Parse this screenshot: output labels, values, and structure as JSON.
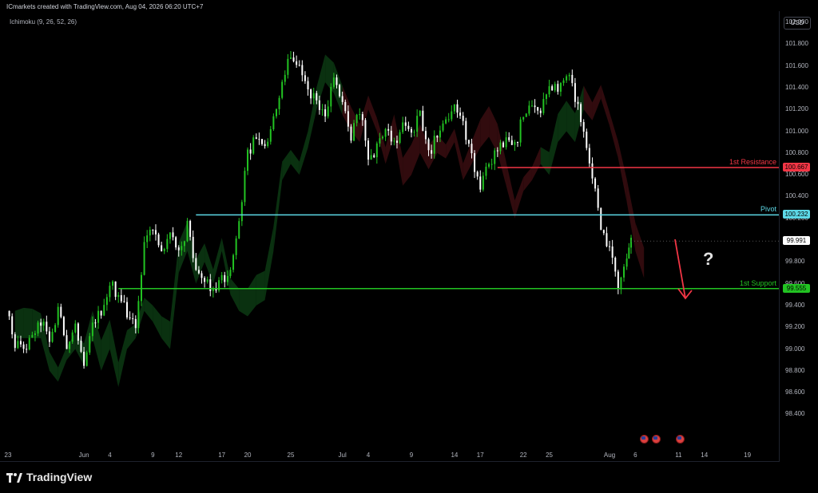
{
  "header": {
    "created": "ICmarkets created with TradingView.com, Aug 04, 2026 06:20 UTC+7",
    "indicator": "Ichimoku (9, 26, 52, 26)",
    "currency": "USD"
  },
  "brand": {
    "name": "TradingView"
  },
  "chart_data": {
    "type": "candlestick",
    "ylim": [
      98.2,
      102.15
    ],
    "y_ticks": [
      "102.000",
      "101.800",
      "101.600",
      "101.400",
      "101.200",
      "101.000",
      "100.800",
      "100.600",
      "100.400",
      "100.200",
      "99.800",
      "99.600",
      "99.400",
      "99.200",
      "99.000",
      "98.800",
      "98.600",
      "98.400"
    ],
    "x_ticks": [
      "23",
      "Jun",
      "4",
      "9",
      "12",
      "17",
      "20",
      "25",
      "Jul",
      "4",
      "9",
      "14",
      "17",
      "22",
      "25",
      "Aug",
      "6",
      "11",
      "14",
      "19"
    ],
    "x_tick_days": [
      -9,
      0,
      3,
      8,
      11,
      16,
      19,
      24,
      30,
      33,
      38,
      43,
      46,
      51,
      54,
      61,
      64,
      69,
      72,
      77
    ],
    "x_range_days": [
      -9,
      80
    ],
    "current_price": "99.991",
    "levels": [
      {
        "name": "1st Resistance",
        "value": "100.667",
        "color": "#f23645",
        "from_day": 48
      },
      {
        "name": "Pivot",
        "value": "100.232",
        "color": "#5dd8e6",
        "from_day": 13
      },
      {
        "name": "1st Support",
        "value": "99.555",
        "color": "#22c322",
        "from_day": 4
      }
    ],
    "annotation": "?",
    "price_path": [
      [
        -9,
        99.35
      ],
      [
        -8,
        99.05
      ],
      [
        -7,
        98.95
      ],
      [
        -6,
        99.15
      ],
      [
        -5,
        99.25
      ],
      [
        -4,
        99.1
      ],
      [
        -3,
        99.35
      ],
      [
        -2,
        99.05
      ],
      [
        -1,
        99.25
      ],
      [
        0,
        98.9
      ],
      [
        1,
        99.25
      ],
      [
        2,
        99.35
      ],
      [
        3,
        99.6
      ],
      [
        4,
        99.5
      ],
      [
        5,
        99.35
      ],
      [
        6,
        99.25
      ],
      [
        7,
        99.95
      ],
      [
        8,
        100.15
      ],
      [
        9,
        99.85
      ],
      [
        10,
        100.05
      ],
      [
        11,
        99.85
      ],
      [
        12,
        100.15
      ],
      [
        13,
        99.75
      ],
      [
        14,
        99.6
      ],
      [
        15,
        99.55
      ],
      [
        16,
        99.65
      ],
      [
        17,
        99.7
      ],
      [
        18,
        100.15
      ],
      [
        19,
        100.8
      ],
      [
        20,
        100.95
      ],
      [
        21,
        100.85
      ],
      [
        22,
        101.1
      ],
      [
        23,
        101.45
      ],
      [
        24,
        101.7
      ],
      [
        25,
        101.6
      ],
      [
        26,
        101.4
      ],
      [
        27,
        101.25
      ],
      [
        28,
        101.15
      ],
      [
        29,
        101.45
      ],
      [
        30,
        101.25
      ],
      [
        31,
        100.95
      ],
      [
        32,
        101.2
      ],
      [
        33,
        100.75
      ],
      [
        34,
        100.85
      ],
      [
        35,
        101.05
      ],
      [
        36,
        100.9
      ],
      [
        37,
        101.05
      ],
      [
        38,
        101.0
      ],
      [
        39,
        101.15
      ],
      [
        40,
        100.8
      ],
      [
        41,
        100.95
      ],
      [
        42,
        101.1
      ],
      [
        43,
        101.2
      ],
      [
        44,
        101.05
      ],
      [
        45,
        100.75
      ],
      [
        46,
        100.45
      ],
      [
        47,
        100.7
      ],
      [
        48,
        100.8
      ],
      [
        49,
        100.95
      ],
      [
        50,
        100.85
      ],
      [
        51,
        101.15
      ],
      [
        52,
        101.25
      ],
      [
        53,
        101.15
      ],
      [
        54,
        101.45
      ],
      [
        55,
        101.35
      ],
      [
        56,
        101.55
      ],
      [
        57,
        101.3
      ],
      [
        58,
        101.0
      ],
      [
        59,
        100.6
      ],
      [
        60,
        100.15
      ],
      [
        61,
        99.9
      ],
      [
        62,
        99.6
      ],
      [
        63,
        99.85
      ],
      [
        63.5,
        99.99
      ]
    ]
  }
}
